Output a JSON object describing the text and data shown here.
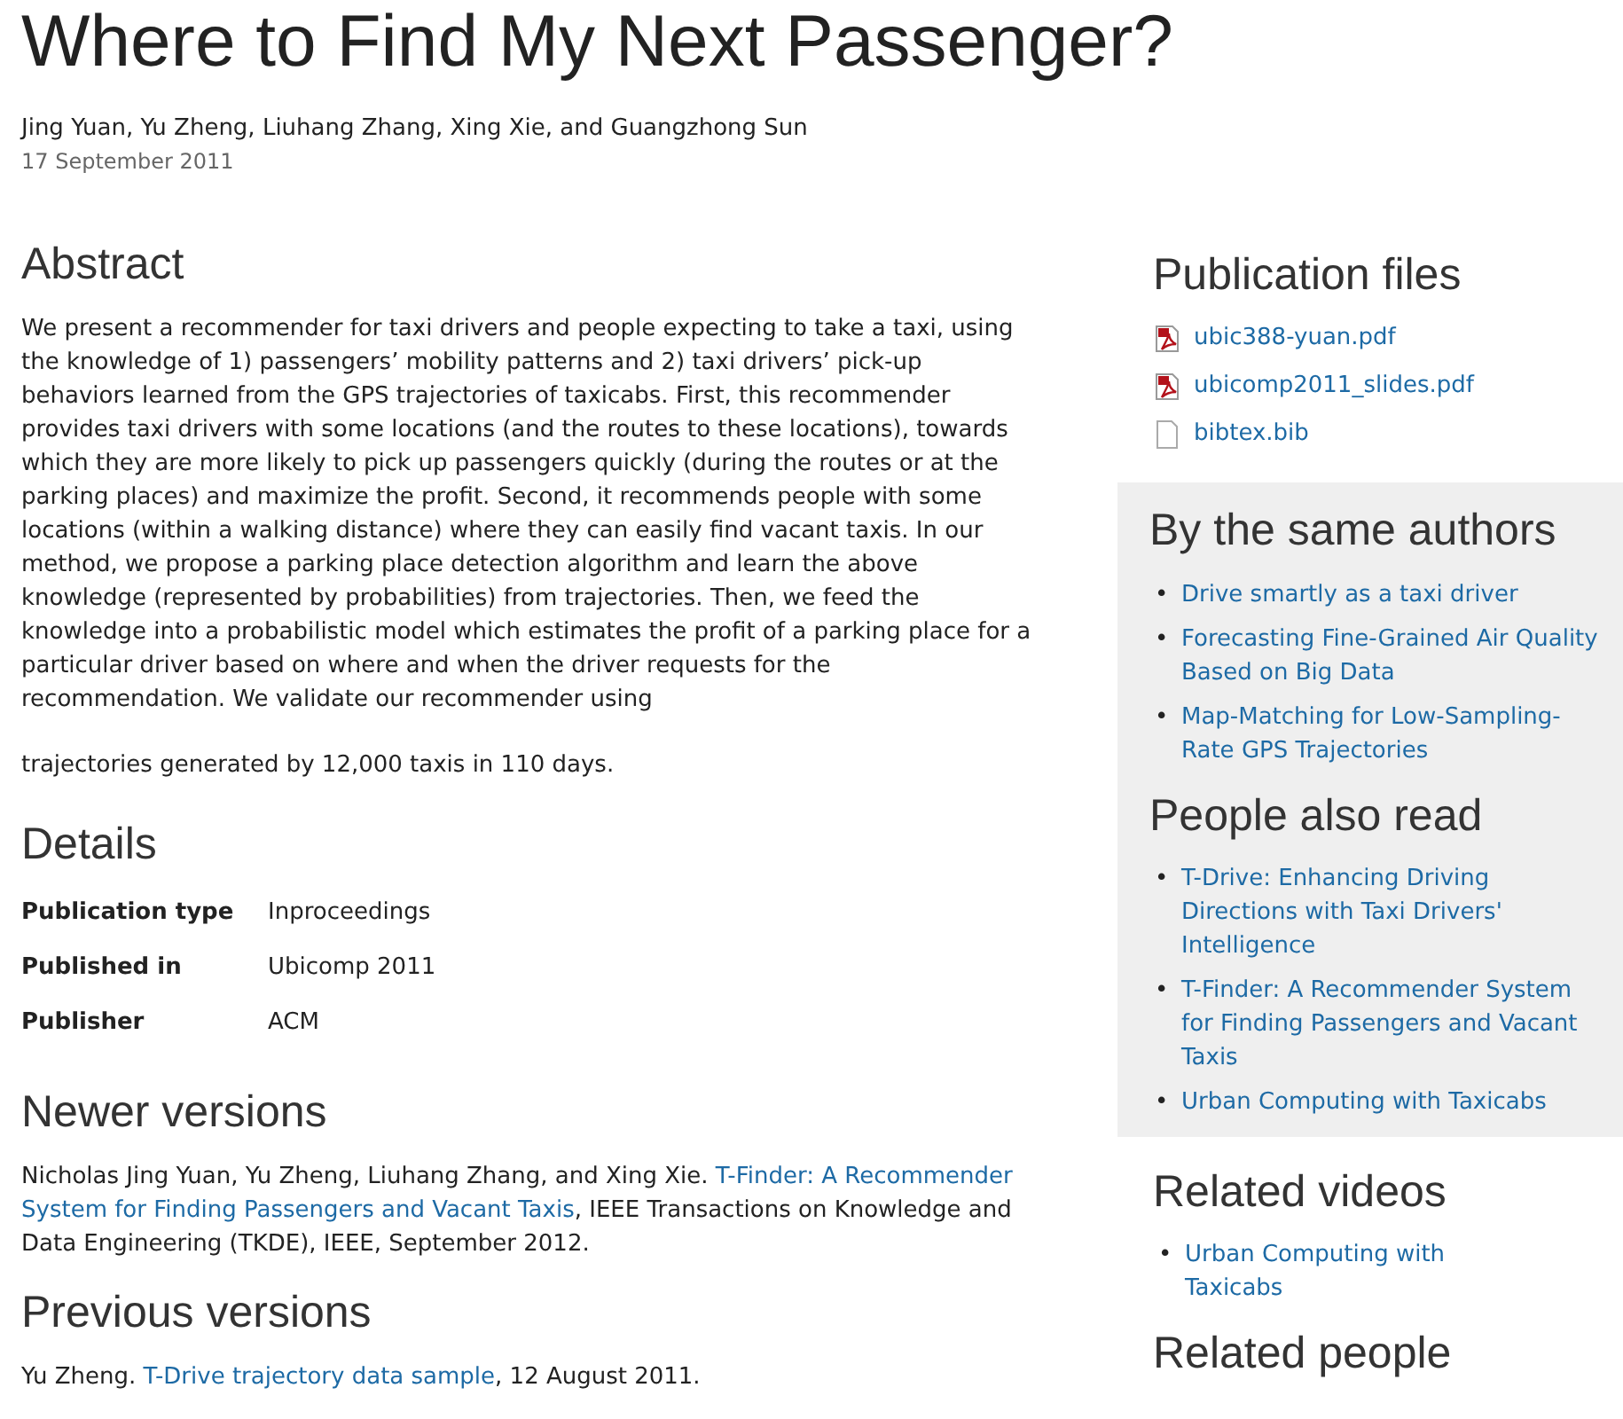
{
  "title": "Where to Find My Next Passenger?",
  "authors": "Jing Yuan, Yu Zheng, Liuhang Zhang, Xing Xie, and Guangzhong Sun",
  "date": "17 September 2011",
  "abstract": {
    "heading": "Abstract",
    "paragraphs": [
      "We present a recommender for taxi drivers and people expecting to take a taxi, using the knowledge of 1) passengers’ mobility patterns and 2) taxi drivers’ pick-up behaviors learned from the GPS trajectories of taxicabs. First, this recommender provides taxi drivers with some locations (and the routes to these locations), towards which they are more likely to pick up passengers quickly (during the routes or at the parking places) and maximize the profit. Second, it recommends people with some locations (within a walking distance) where they can easily find vacant taxis. In our method, we propose a parking place detection algorithm and learn the above knowledge (represented by probabilities) from trajectories. Then, we feed the knowledge into a probabilistic model which estimates the profit of a parking place for a particular driver based on where and when the driver requests for the recommendation. We validate our recommender using",
      "trajectories generated by 12,000 taxis in 110 days."
    ]
  },
  "details": {
    "heading": "Details",
    "rows": [
      {
        "label": "Publication type",
        "value": "Inproceedings"
      },
      {
        "label": "Published in",
        "value": "Ubicomp 2011"
      },
      {
        "label": "Publisher",
        "value": "ACM"
      }
    ]
  },
  "newer_versions": {
    "heading": "Newer versions",
    "before": "Nicholas Jing Yuan, Yu Zheng, Liuhang Zhang, and Xing Xie. ",
    "link_lines": [
      "T-Finder: A Recommender",
      "System for Finding Passengers and Vacant Taxis"
    ],
    "after": ", IEEE Transactions on Knowledge and Data Engineering (TKDE), IEEE, September 2012."
  },
  "previous_versions": {
    "heading": "Previous versions",
    "before": "Yu Zheng. ",
    "link_lines": [
      "T-Drive trajectory data sample"
    ],
    "after": ", 12 August 2011."
  },
  "publication_files": {
    "heading": "Publication files",
    "files": [
      {
        "name": "ubic388-yuan.pdf",
        "kind": "pdf"
      },
      {
        "name": "ubicomp2011_slides.pdf",
        "kind": "pdf"
      },
      {
        "name": "bibtex.bib",
        "kind": "file"
      }
    ]
  },
  "same_authors": {
    "heading": "By the same authors",
    "items": [
      {
        "marker": "•",
        "title": "Drive smartly as a taxi driver"
      },
      {
        "marker": "•",
        "title": "Forecasting Fine-Grained Air Quality Based on Big Data"
      },
      {
        "marker": "•",
        "title": "Map-Matching for Low-Sampling-Rate GPS Trajectories"
      }
    ]
  },
  "people_also_read": {
    "heading": "People also read",
    "items": [
      {
        "marker": "•",
        "title": "T-Drive: Enhancing Driving Directions with Taxi Drivers' Intelligence"
      },
      {
        "marker": "•",
        "title": "T-Finder: A Recommender System for Finding Passengers and Vacant Taxis"
      },
      {
        "marker": "•",
        "title": "Urban Computing with Taxicabs"
      }
    ]
  },
  "related_videos": {
    "heading": "Related videos",
    "items": [
      {
        "marker": "•",
        "title": "Urban Computing with Taxicabs"
      }
    ]
  },
  "related_people": {
    "heading": "Related people"
  }
}
